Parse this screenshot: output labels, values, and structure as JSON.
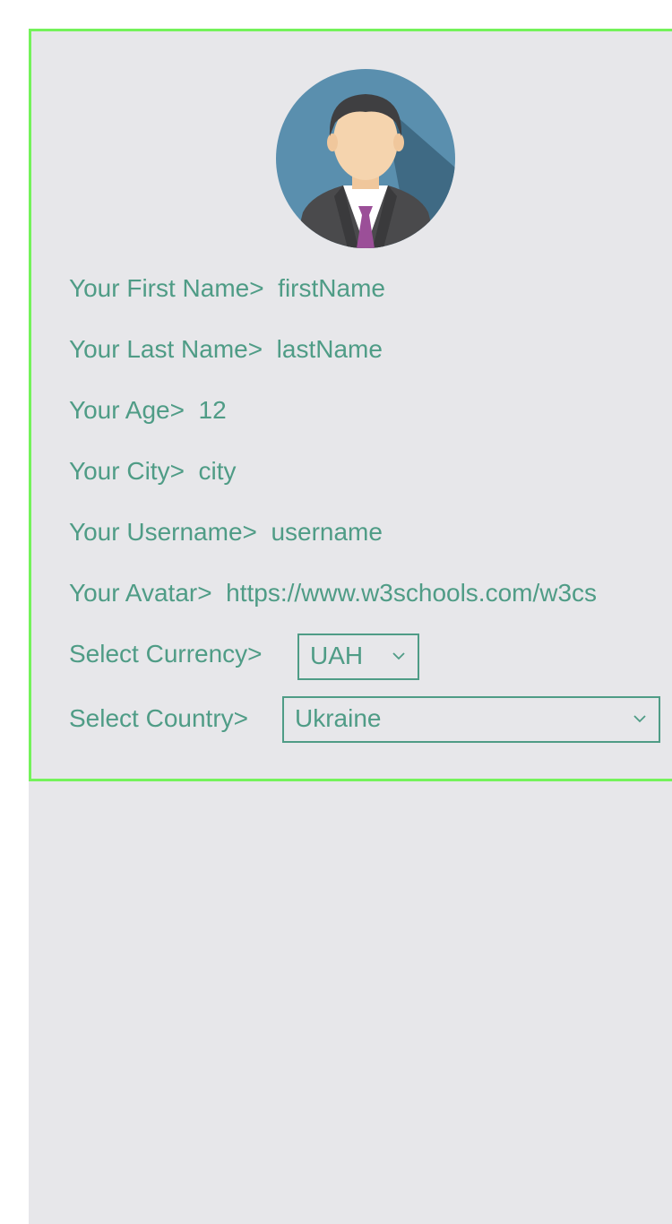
{
  "profile": {
    "avatar_icon": "user-avatar-businessman",
    "first_name_label": "Your First Name>",
    "first_name_value": "firstName",
    "last_name_label": "Your Last Name>",
    "last_name_value": "lastName",
    "age_label": "Your Age>",
    "age_value": "12",
    "city_label": "Your City>",
    "city_value": "city",
    "username_label": "Your Username>",
    "username_value": "username",
    "avatar_label": "Your Avatar>",
    "avatar_value": "https://www.w3schools.com/w3cs"
  },
  "currency": {
    "label": "Select Currency>",
    "selected": "UAH"
  },
  "country": {
    "label": "Select Country>",
    "selected": "Ukraine"
  },
  "colors": {
    "text": "#4f9c86",
    "border": "#74f25a",
    "background": "#e7e7ea"
  }
}
